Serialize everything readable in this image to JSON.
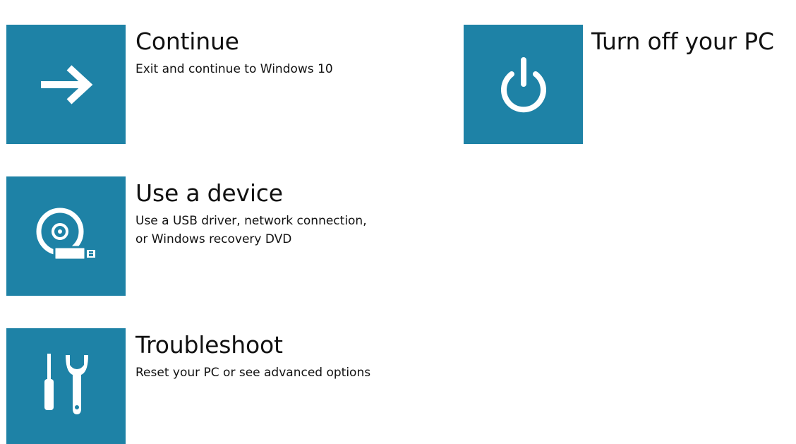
{
  "options": {
    "continue": {
      "title": "Continue",
      "description": "Exit and continue to Windows 10",
      "icon": "arrow-right-icon"
    },
    "use_device": {
      "title": "Use a device",
      "description": "Use a USB driver, network connection,\nor Windows recovery DVD",
      "icon": "disc-usb-icon"
    },
    "troubleshoot": {
      "title": "Troubleshoot",
      "description": "Reset your PC or see advanced options",
      "icon": "tools-icon"
    },
    "turn_off": {
      "title": "Turn off your PC",
      "icon": "power-icon"
    }
  },
  "colors": {
    "tile": "#1e82a6",
    "icon": "#ffffff",
    "text": "#111111",
    "background": "#ffffff"
  }
}
